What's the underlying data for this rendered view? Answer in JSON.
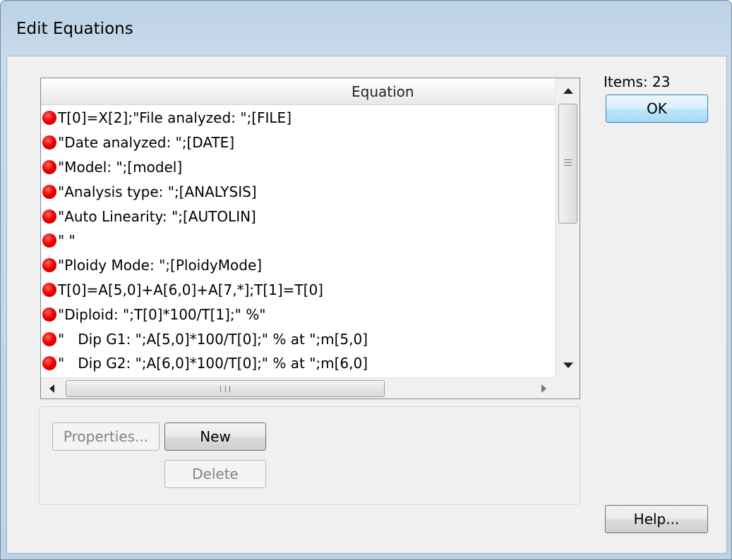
{
  "window": {
    "title": "Edit Equations"
  },
  "list": {
    "column_header": "Equation",
    "rows": [
      "T[0]=X[2];\"File analyzed: \";[FILE]",
      "\"Date analyzed: \";[DATE]",
      "\"Model: \";[model]",
      "\"Analysis type: \";[ANALYSIS]",
      "\"Auto Linearity: \";[AUTOLIN]",
      "\" \"",
      "\"Ploidy Mode: \";[PloidyMode]",
      "T[0]=A[5,0]+A[6,0]+A[7,*];T[1]=T[0]",
      "\"Diploid: \";T[0]*100/T[1];\" %\"",
      "\"   Dip G1: \";A[5,0]*100/T[0];\" % at \";m[5,0]",
      "\"   Dip G2: \";A[6,0]*100/T[0];\" % at \";m[6,0]"
    ],
    "row_icon": "red-dot-icon",
    "row_icon_color": "#e00000"
  },
  "side": {
    "items_label": "Items: 23",
    "ok_label": "OK",
    "help_label": "Help..."
  },
  "actions": {
    "properties_label": "Properties...",
    "new_label": "New",
    "delete_label": "Delete"
  }
}
